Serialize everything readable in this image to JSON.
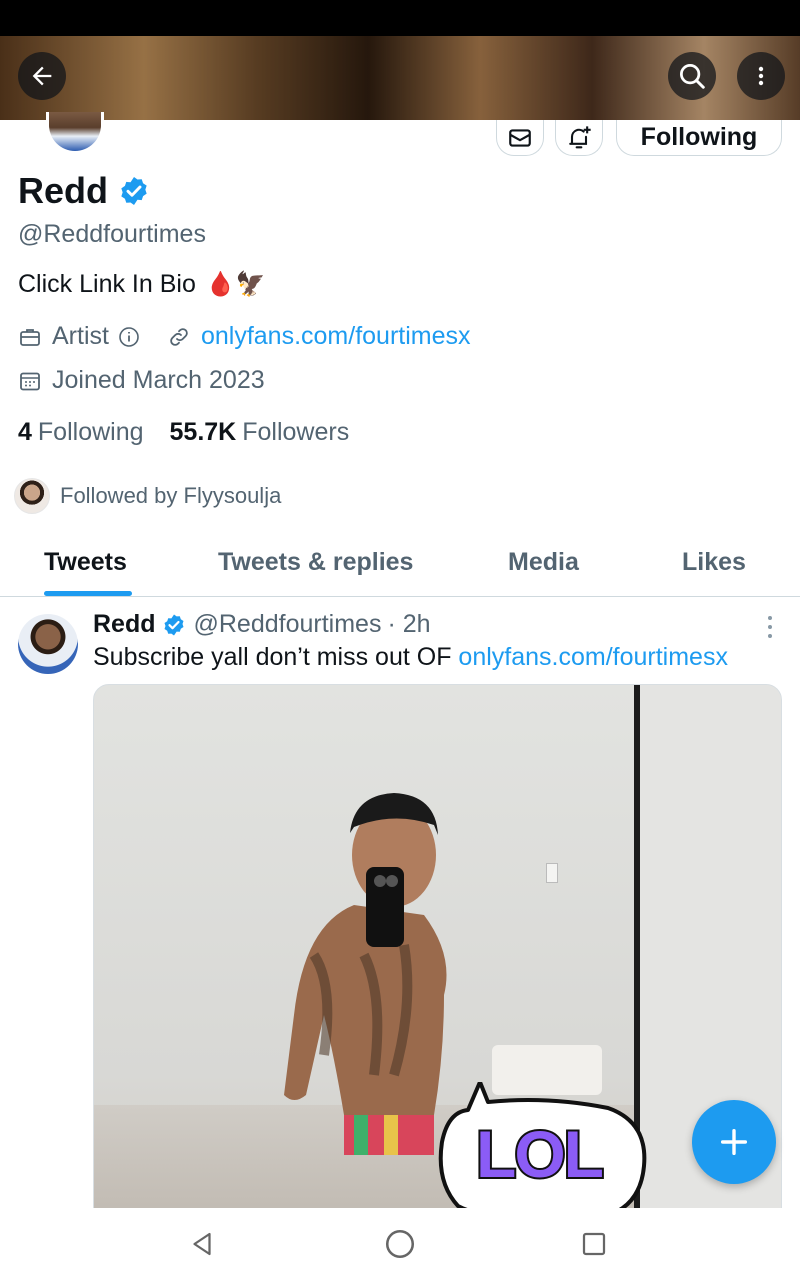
{
  "profile": {
    "name": "Redd",
    "handle": "@Reddfourtimes",
    "bio": "Click Link In Bio",
    "bio_emojis": "🩸🦅",
    "category": "Artist",
    "website": "onlyfans.com/fourtimesx",
    "joined": "Joined March 2023",
    "following_count": "4",
    "following_label": "Following",
    "followers_count": "55.7K",
    "followers_label": "Followers",
    "followed_by": "Followed by Flyysoulja",
    "follow_button": "Following"
  },
  "tabs": [
    {
      "label": "Tweets",
      "active": true
    },
    {
      "label": "Tweets & replies",
      "active": false
    },
    {
      "label": "Media",
      "active": false
    },
    {
      "label": "Likes",
      "active": false
    }
  ],
  "tweet": {
    "name": "Redd",
    "handle": "@Reddfourtimes",
    "time": "· 2h",
    "text": "Subscribe yall don’t miss out OF ",
    "link": "onlyfans.com/fourtimesx"
  },
  "sticker": {
    "text": "LOL"
  },
  "colors": {
    "accent": "#1d9bf0",
    "text": "#0f1419",
    "secondary": "#536471",
    "border": "#cfd9de"
  },
  "icons": [
    "back-arrow-icon",
    "search-icon",
    "more-vertical-icon",
    "mail-icon",
    "bell-plus-icon",
    "verified-badge-icon",
    "briefcase-icon",
    "info-icon",
    "link-icon",
    "calendar-icon",
    "plus-icon",
    "nav-back-icon",
    "nav-home-icon",
    "nav-recents-icon"
  ]
}
